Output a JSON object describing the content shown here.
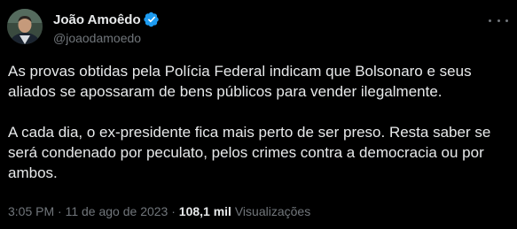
{
  "author": {
    "display_name": "João Amoêdo",
    "handle": "@joaodamoedo",
    "avatar_icon": "avatar-photo",
    "verified_icon": "verified-badge-icon",
    "verified_color": "#1d9bf0"
  },
  "tweet": {
    "paragraphs": [
      "As provas obtidas pela Polícia Federal indicam que Bolsonaro e seus aliados se apossaram de bens públicos para vender ilegalmente.",
      "A cada dia, o ex-presidente fica mais perto de ser preso. Resta saber se será condenado por peculato, pelos crimes contra a democracia ou por ambos."
    ]
  },
  "meta": {
    "time": "3:05 PM",
    "separator": "·",
    "date": "11 de ago de 2023",
    "views_count": "108,1 mil",
    "views_label": "Visualizações"
  },
  "colors": {
    "background": "#000000",
    "text": "#e7e9ea",
    "secondary": "#71767b"
  }
}
